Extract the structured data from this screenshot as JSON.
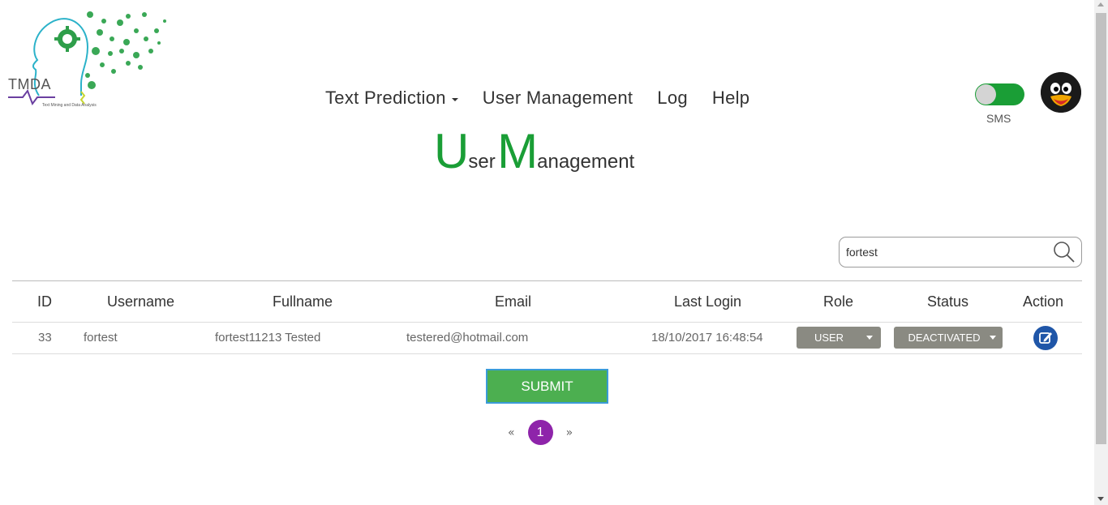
{
  "logo": {
    "text": "TMDA",
    "subtitle": "Text Mining and Data Analysis"
  },
  "nav": {
    "items": [
      {
        "label": "Text Prediction",
        "has_dropdown": true
      },
      {
        "label": "User Management",
        "has_dropdown": false
      },
      {
        "label": "Log",
        "has_dropdown": false
      },
      {
        "label": "Help",
        "has_dropdown": false
      }
    ]
  },
  "sms_toggle": {
    "label": "SMS",
    "on": true,
    "color": "#1a9e36"
  },
  "page_title": {
    "w1_initial": "U",
    "w1_rest": "ser",
    "w2_initial": "M",
    "w2_rest": "anagement",
    "color": "#1a9e36"
  },
  "search": {
    "value": "fortest",
    "placeholder": ""
  },
  "table": {
    "headers": [
      "ID",
      "Username",
      "Fullname",
      "Email",
      "Last Login",
      "Role",
      "Status",
      "Action"
    ],
    "rows": [
      {
        "id": "33",
        "username": "fortest",
        "fullname": "fortest11213 Tested",
        "email": "testered@hotmail.com",
        "last_login": "18/10/2017 16:48:54",
        "role": "USER",
        "status": "DEACTIVATED",
        "action_icon": "edit-icon"
      }
    ]
  },
  "submit": {
    "label": "SUBMIT",
    "color": "#4caf50"
  },
  "pagination": {
    "prev": "«",
    "current": "1",
    "next": "»",
    "active_color": "#8e24aa"
  }
}
